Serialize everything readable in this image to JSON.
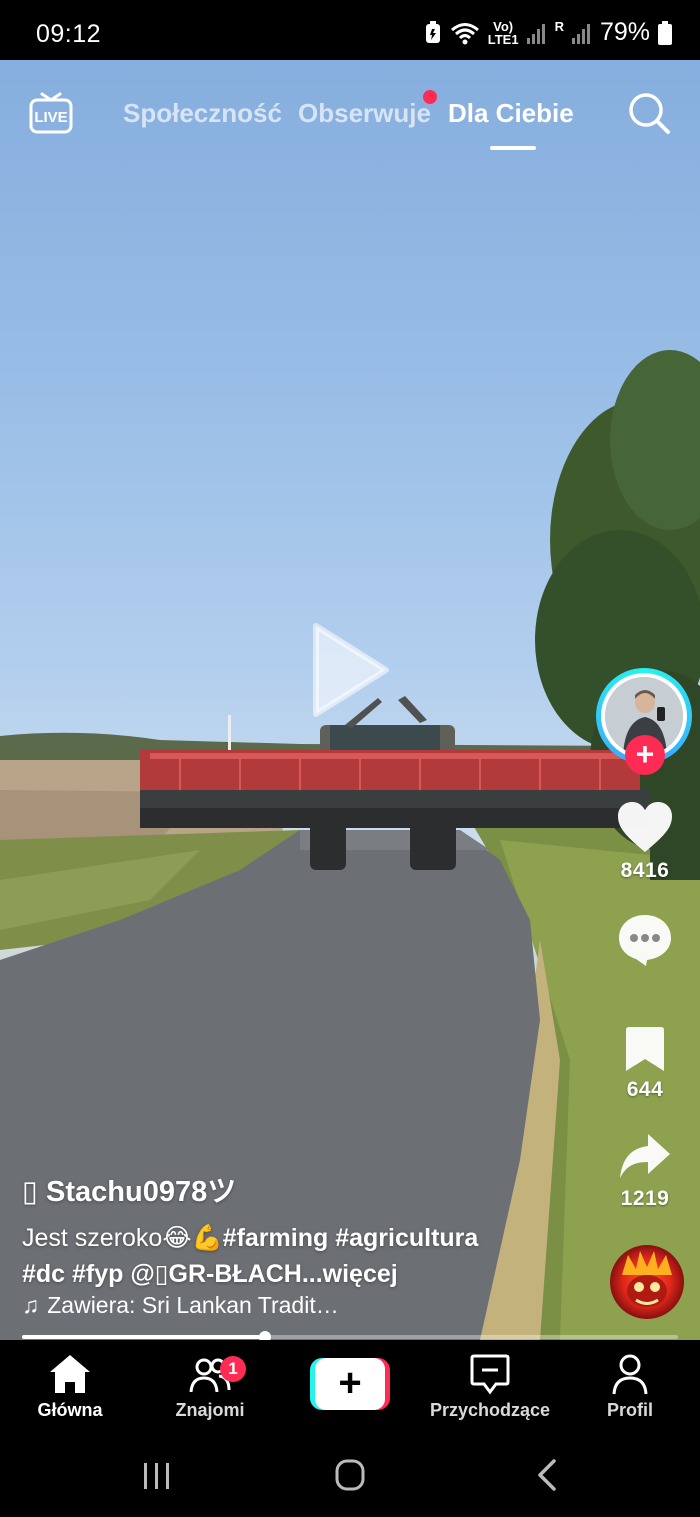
{
  "status_bar": {
    "time": "09:12",
    "network_small_top": "Vo)",
    "network_small_bottom": "LTE1",
    "roaming": "R",
    "battery": "79%"
  },
  "top_nav": {
    "tabs": [
      {
        "label": "Społeczność",
        "active": false
      },
      {
        "label": "Obserwuje",
        "active": false,
        "has_dot": true
      },
      {
        "label": "Dla Ciebie",
        "active": true
      }
    ],
    "live_icon": "live-tv-icon",
    "search_icon": "search-icon"
  },
  "video": {
    "state": "paused",
    "progress_fraction": 0.37
  },
  "right_rail": {
    "likes": "8416",
    "bookmarks": "644",
    "shares": "1219",
    "follow_symbol": "+"
  },
  "caption": {
    "username": "▯ Stachu0978ツ",
    "text_plain": "Jest szeroko😂💪",
    "hashtags_line1": "#farming #agricultura",
    "hashtags_line2": "#dc #fyp @▯GR-BŁACH",
    "more": "...więcej",
    "music_note": "♫",
    "music": "Zawiera: Sri Lankan Tradit…"
  },
  "bottom_nav": {
    "items": [
      {
        "label": "Główna",
        "icon": "home-icon",
        "active": true
      },
      {
        "label": "Znajomi",
        "icon": "friends-icon",
        "badge": "1"
      },
      {
        "label": "+",
        "icon": "create-icon"
      },
      {
        "label": "Przychodzące",
        "icon": "inbox-icon"
      },
      {
        "label": "Profil",
        "icon": "profile-icon"
      }
    ]
  },
  "colors": {
    "accent_red": "#fe2c55",
    "accent_cyan": "#25f4ee"
  }
}
